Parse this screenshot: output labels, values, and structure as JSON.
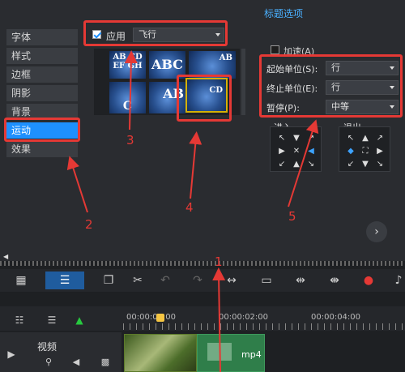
{
  "header": {
    "title_options": "标题选项"
  },
  "sidebar": {
    "items": [
      "字体",
      "样式",
      "边框",
      "阴影",
      "背景",
      "运动",
      "效果"
    ],
    "active": "运动"
  },
  "apply": {
    "label": "应用",
    "checked": true,
    "motion_value": "飞行"
  },
  "thumbnails": [
    {
      "text": "AB CD EF GH"
    },
    {
      "text": "ABC"
    },
    {
      "text": "AB"
    },
    {
      "text": "C"
    },
    {
      "text": "AB"
    },
    {
      "text": "CD"
    }
  ],
  "accelerate": {
    "label": "加速(A)"
  },
  "units": {
    "start_label": "起始单位(S):",
    "start_value": "行",
    "end_label": "终止单位(E):",
    "end_value": "行",
    "pause_label": "暂停(P):",
    "pause_value": "中等"
  },
  "enter_label": "进入",
  "exit_label": "退出",
  "callouts": [
    "1",
    "2",
    "3",
    "4",
    "5"
  ],
  "timeline": {
    "timecodes": [
      "00:00:00:00",
      "00:00:02:00",
      "00:00:04:00"
    ],
    "track_label": "视频",
    "clip_label": "mp4"
  },
  "colors": {
    "accent": "#1e90ff",
    "callout": "#e53935"
  }
}
